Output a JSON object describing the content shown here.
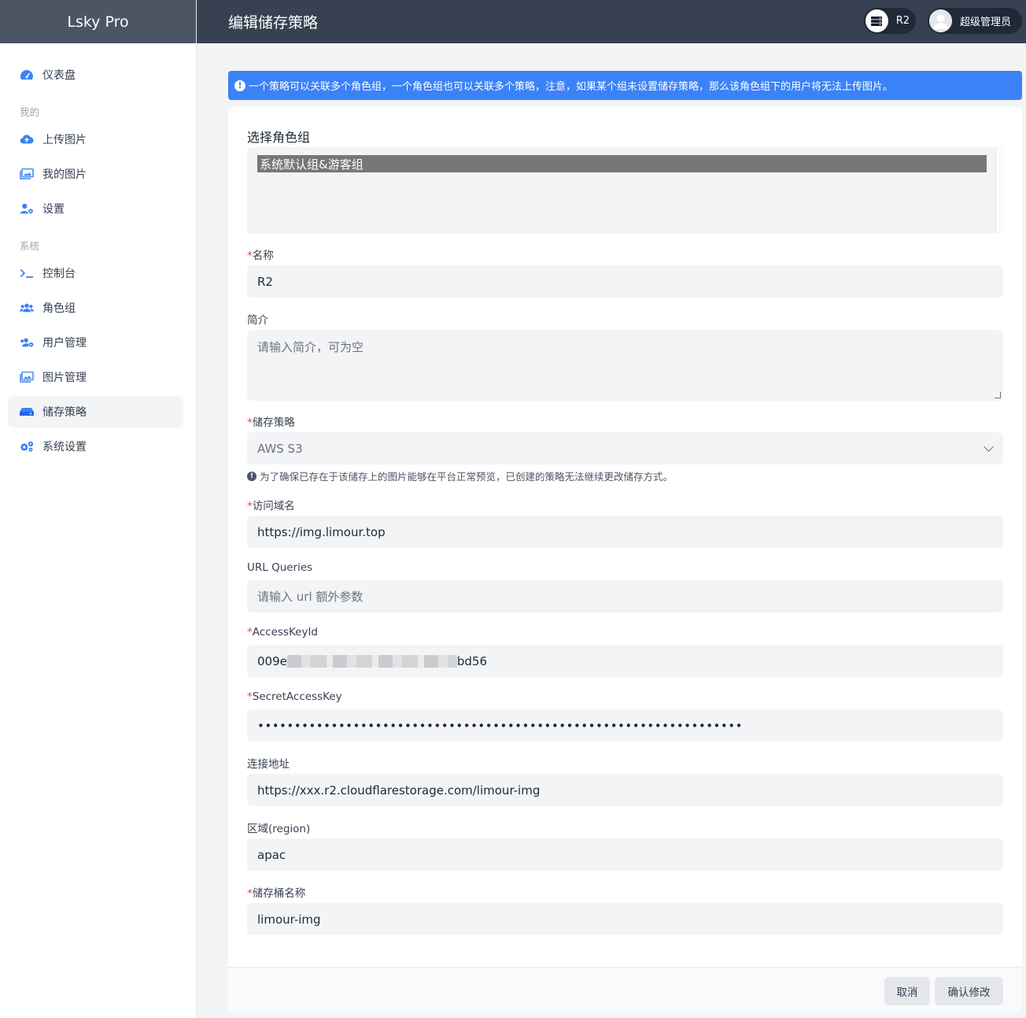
{
  "app": {
    "brand": "Lsky Pro",
    "page_title": "编辑储存策略"
  },
  "topbar": {
    "strategy_chip": "R2",
    "user_chip": "超级管理员"
  },
  "sidebar": {
    "dashboard": "仪表盘",
    "section_mine": "我的",
    "upload": "上传图片",
    "my_images": "我的图片",
    "settings": "设置",
    "section_system": "系统",
    "console": "控制台",
    "roles": "角色组",
    "users": "用户管理",
    "images": "图片管理",
    "strategies": "储存策略",
    "system_settings": "系统设置"
  },
  "alert": {
    "text": "一个策略可以关联多个角色组，一个角色组也可以关联多个策略，注意，如果某个组未设置储存策略，那么该角色组下的用户将无法上传图片。"
  },
  "form": {
    "role_group_label": "选择角色组",
    "role_group_selected": "系统默认组&游客组",
    "name_label": "名称",
    "name_value": "R2",
    "intro_label": "简介",
    "intro_placeholder": "请输入简介，可为空",
    "driver_label": "储存策略",
    "driver_value": "AWS S3",
    "driver_hint": "为了确保已存在于该储存上的图片能够在平台正常预览，已创建的策略无法继续更改储存方式。",
    "domain_label": "访问域名",
    "domain_value": "https://img.limour.top",
    "queries_label": "URL Queries",
    "queries_placeholder": "请输入 url 额外参数",
    "key_id_label": "AccessKeyId",
    "key_id_prefix": "009e",
    "key_id_suffix": "bd56",
    "secret_label": "SecretAccessKey",
    "secret_value": "••••••••••••••••••••••••••••••••••••••••••••••••••••••••••••••••••",
    "endpoint_label": "连接地址",
    "endpoint_value": "https://xxx.r2.cloudflarestorage.com/limour-img",
    "region_label": "区域(region)",
    "region_value": "apac",
    "bucket_label": "储存桶名称",
    "bucket_value": "limour-img",
    "required_mark": "*"
  },
  "buttons": {
    "cancel": "取消",
    "confirm": "确认修改"
  },
  "colors": {
    "accent": "#3b82f6",
    "topbar": "#374151",
    "brand_bg": "#4b5563",
    "required": "#ef4444"
  }
}
